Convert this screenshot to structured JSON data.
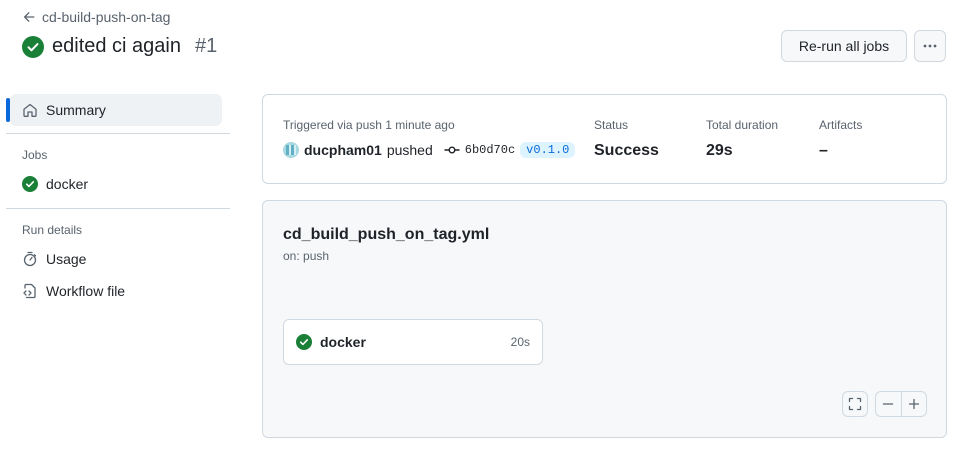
{
  "header": {
    "back_label": "cd-build-push-on-tag",
    "title": "edited ci again",
    "run_number": "#1",
    "rerun_label": "Re-run all jobs"
  },
  "sidebar": {
    "summary_label": "Summary",
    "jobs_heading": "Jobs",
    "jobs": [
      {
        "label": "docker",
        "status": "success"
      }
    ],
    "run_details_heading": "Run details",
    "run_details": [
      {
        "label": "Usage",
        "icon": "stopwatch-icon"
      },
      {
        "label": "Workflow file",
        "icon": "file-code-icon"
      }
    ]
  },
  "summary": {
    "trigger_label": "Triggered via push 1 minute ago",
    "user": "ducpham01",
    "action": "pushed",
    "commit_sha": "6b0d70c",
    "tag": "v0.1.0",
    "status_label": "Status",
    "status_value": "Success",
    "duration_label": "Total duration",
    "duration_value": "29s",
    "artifacts_label": "Artifacts",
    "artifacts_value": "–"
  },
  "graph": {
    "workflow_file": "cd_build_push_on_tag.yml",
    "trigger": "on: push",
    "job": {
      "name": "docker",
      "duration": "20s"
    }
  },
  "colors": {
    "success": "#1a7f37",
    "accent": "#0969da",
    "border": "#d1d9e0"
  }
}
